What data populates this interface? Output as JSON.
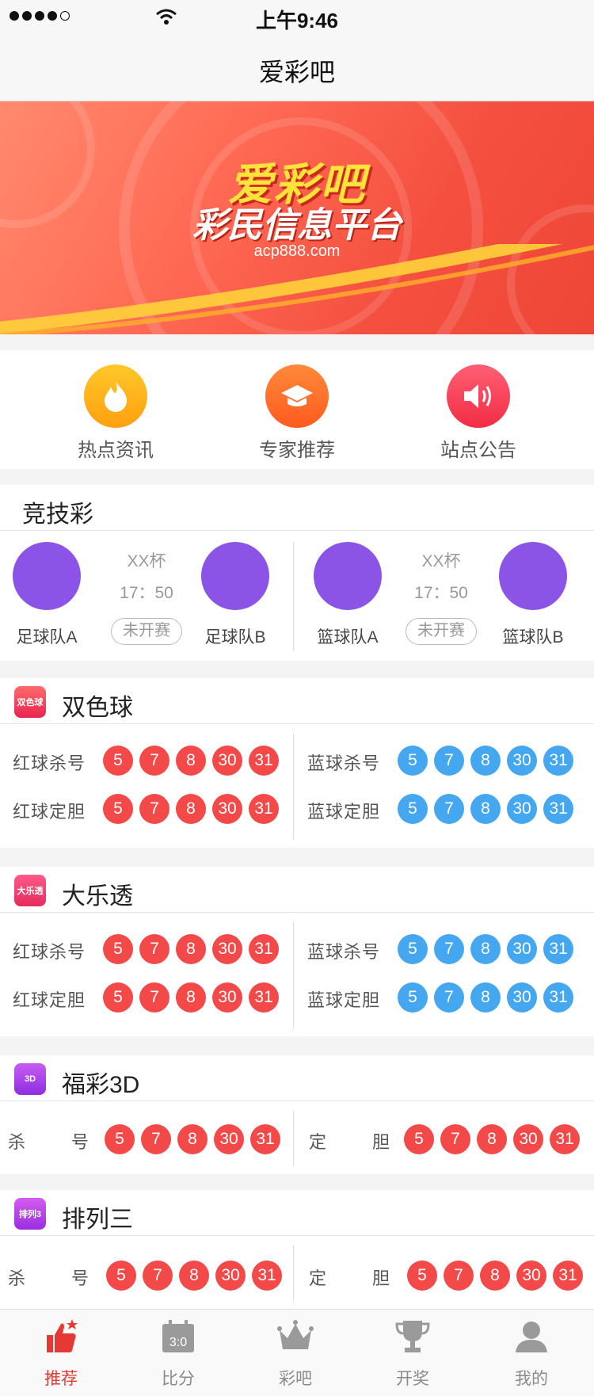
{
  "status_bar": {
    "time": "上午9:46"
  },
  "nav": {
    "title": "爱彩吧"
  },
  "banner": {
    "title": "爱彩吧",
    "subtitle": "彩民信息平台",
    "url": "acp888.com"
  },
  "quick_links": [
    {
      "label": "热点资讯",
      "icon": "flame-icon",
      "color": "#ffb21c"
    },
    {
      "label": "专家推荐",
      "icon": "graduation-cap-icon",
      "color": "#ff6a2b"
    },
    {
      "label": "站点公告",
      "icon": "speaker-icon",
      "color": "#ff3f5b"
    }
  ],
  "jingcai": {
    "title": "竞技彩",
    "matches": [
      {
        "cup": "XX杯",
        "time": "17：50",
        "status": "未开赛",
        "team_a": "足球队A",
        "team_b": "足球队B"
      },
      {
        "cup": "XX杯",
        "time": "17：50",
        "status": "未开赛",
        "team_a": "篮球队A",
        "team_b": "篮球队B"
      }
    ]
  },
  "shuangseqiu": {
    "title": "双色球",
    "logo_text": "双色球",
    "left": [
      {
        "label": "红球杀号",
        "balls": [
          "5",
          "7",
          "8",
          "30",
          "31"
        ]
      },
      {
        "label": "红球定胆",
        "balls": [
          "5",
          "7",
          "8",
          "30",
          "31"
        ]
      }
    ],
    "right": [
      {
        "label": "蓝球杀号",
        "balls": [
          "5",
          "7",
          "8",
          "30",
          "31"
        ]
      },
      {
        "label": "蓝球定胆",
        "balls": [
          "5",
          "7",
          "8",
          "30",
          "31"
        ]
      }
    ]
  },
  "daletou": {
    "title": "大乐透",
    "logo_text": "大乐透",
    "left": [
      {
        "label": "红球杀号",
        "balls": [
          "5",
          "7",
          "8",
          "30",
          "31"
        ]
      },
      {
        "label": "红球定胆",
        "balls": [
          "5",
          "7",
          "8",
          "30",
          "31"
        ]
      }
    ],
    "right": [
      {
        "label": "蓝球杀号",
        "balls": [
          "5",
          "7",
          "8",
          "30",
          "31"
        ]
      },
      {
        "label": "蓝球定胆",
        "balls": [
          "5",
          "7",
          "8",
          "30",
          "31"
        ]
      }
    ]
  },
  "fucai3d": {
    "title": "福彩3D",
    "logo_text": "3D",
    "left": {
      "label": "杀　号",
      "balls": [
        "5",
        "7",
        "8",
        "30",
        "31"
      ]
    },
    "right": {
      "label": "定　胆",
      "balls": [
        "5",
        "7",
        "8",
        "30",
        "31"
      ]
    }
  },
  "pailie3": {
    "title": "排列三",
    "logo_text": "排列3",
    "left": {
      "label": "杀　号",
      "balls": [
        "5",
        "7",
        "8",
        "30",
        "31"
      ]
    },
    "right": {
      "label": "定　胆",
      "balls": [
        "5",
        "7",
        "8",
        "30",
        "31"
      ]
    }
  },
  "tabs": [
    {
      "label": "推荐",
      "icon": "thumbs-up-icon",
      "active": true
    },
    {
      "label": "比分",
      "icon": "calendar-score-icon",
      "score": "3:0",
      "active": false
    },
    {
      "label": "彩吧",
      "icon": "crown-icon",
      "active": false
    },
    {
      "label": "开奖",
      "icon": "trophy-icon",
      "active": false
    },
    {
      "label": "我的",
      "icon": "user-icon",
      "active": false
    }
  ]
}
